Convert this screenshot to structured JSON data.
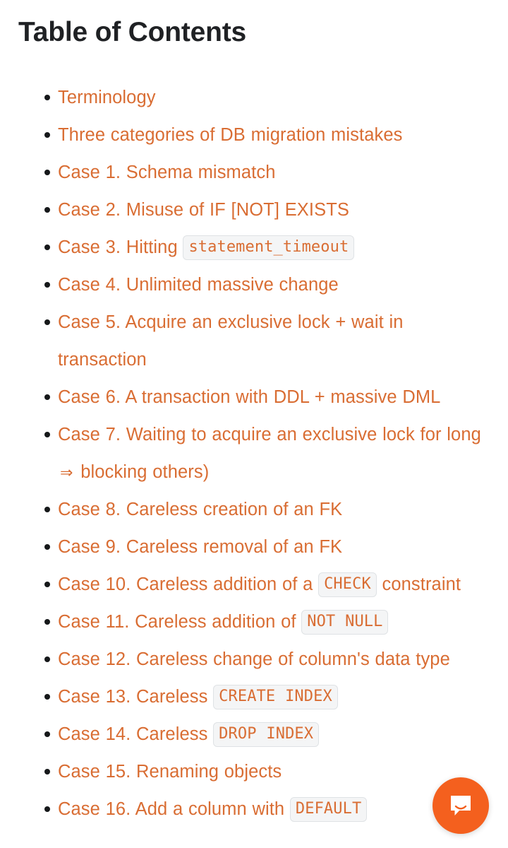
{
  "page": {
    "background_color": "#ffffff",
    "title": "Table of Contents",
    "title_color": "#1f2124",
    "link_color": "#d96d33",
    "code_background_color": "#f4f5f6",
    "code_border_color": "#dfe2e5",
    "bullet_color": "#16181a"
  },
  "toc": {
    "items": [
      {
        "parts": [
          {
            "type": "text",
            "value": "Terminology"
          }
        ]
      },
      {
        "parts": [
          {
            "type": "text",
            "value": "Three categories of DB migration mistakes"
          }
        ]
      },
      {
        "parts": [
          {
            "type": "text",
            "value": "Case 1. Schema mismatch"
          }
        ]
      },
      {
        "parts": [
          {
            "type": "text",
            "value": "Case 2. Misuse of IF [NOT] EXISTS"
          }
        ]
      },
      {
        "parts": [
          {
            "type": "text",
            "value": "Case 3. Hitting "
          },
          {
            "type": "code",
            "value": "statement_timeout"
          }
        ]
      },
      {
        "parts": [
          {
            "type": "text",
            "value": "Case 4. Unlimited massive change"
          }
        ]
      },
      {
        "parts": [
          {
            "type": "text",
            "value": "Case 5. Acquire an exclusive lock + wait in transaction"
          }
        ]
      },
      {
        "parts": [
          {
            "type": "text",
            "value": "Case 6. A transaction with DDL + massive DML"
          }
        ]
      },
      {
        "parts": [
          {
            "type": "text",
            "value": "Case 7. Waiting to acquire an exclusive lock for long "
          },
          {
            "type": "arrow",
            "value": "⇒"
          },
          {
            "type": "text",
            "value": " blocking others)"
          }
        ]
      },
      {
        "parts": [
          {
            "type": "text",
            "value": "Case 8. Careless creation of an FK"
          }
        ]
      },
      {
        "parts": [
          {
            "type": "text",
            "value": "Case 9. Careless removal of an FK"
          }
        ]
      },
      {
        "parts": [
          {
            "type": "text",
            "value": "Case 10. Careless addition of a "
          },
          {
            "type": "code",
            "value": "CHECK"
          },
          {
            "type": "text",
            "value": " constraint"
          }
        ]
      },
      {
        "parts": [
          {
            "type": "text",
            "value": "Case 11. Careless addition of "
          },
          {
            "type": "code",
            "value": "NOT NULL"
          }
        ]
      },
      {
        "parts": [
          {
            "type": "text",
            "value": "Case 12. Careless change of column's data type"
          }
        ]
      },
      {
        "parts": [
          {
            "type": "text",
            "value": "Case 13. Careless "
          },
          {
            "type": "code",
            "value": "CREATE INDEX"
          }
        ]
      },
      {
        "parts": [
          {
            "type": "text",
            "value": "Case 14. Careless "
          },
          {
            "type": "code",
            "value": "DROP INDEX"
          }
        ]
      },
      {
        "parts": [
          {
            "type": "text",
            "value": "Case 15. Renaming objects"
          }
        ]
      },
      {
        "parts": [
          {
            "type": "text",
            "value": "Case 16. Add a column with "
          },
          {
            "type": "code",
            "value": "DEFAULT"
          }
        ]
      }
    ]
  },
  "chat_widget": {
    "icon": "chat-bubble-smile-icon",
    "background_color": "#f4601e",
    "icon_color": "#ffffff"
  }
}
